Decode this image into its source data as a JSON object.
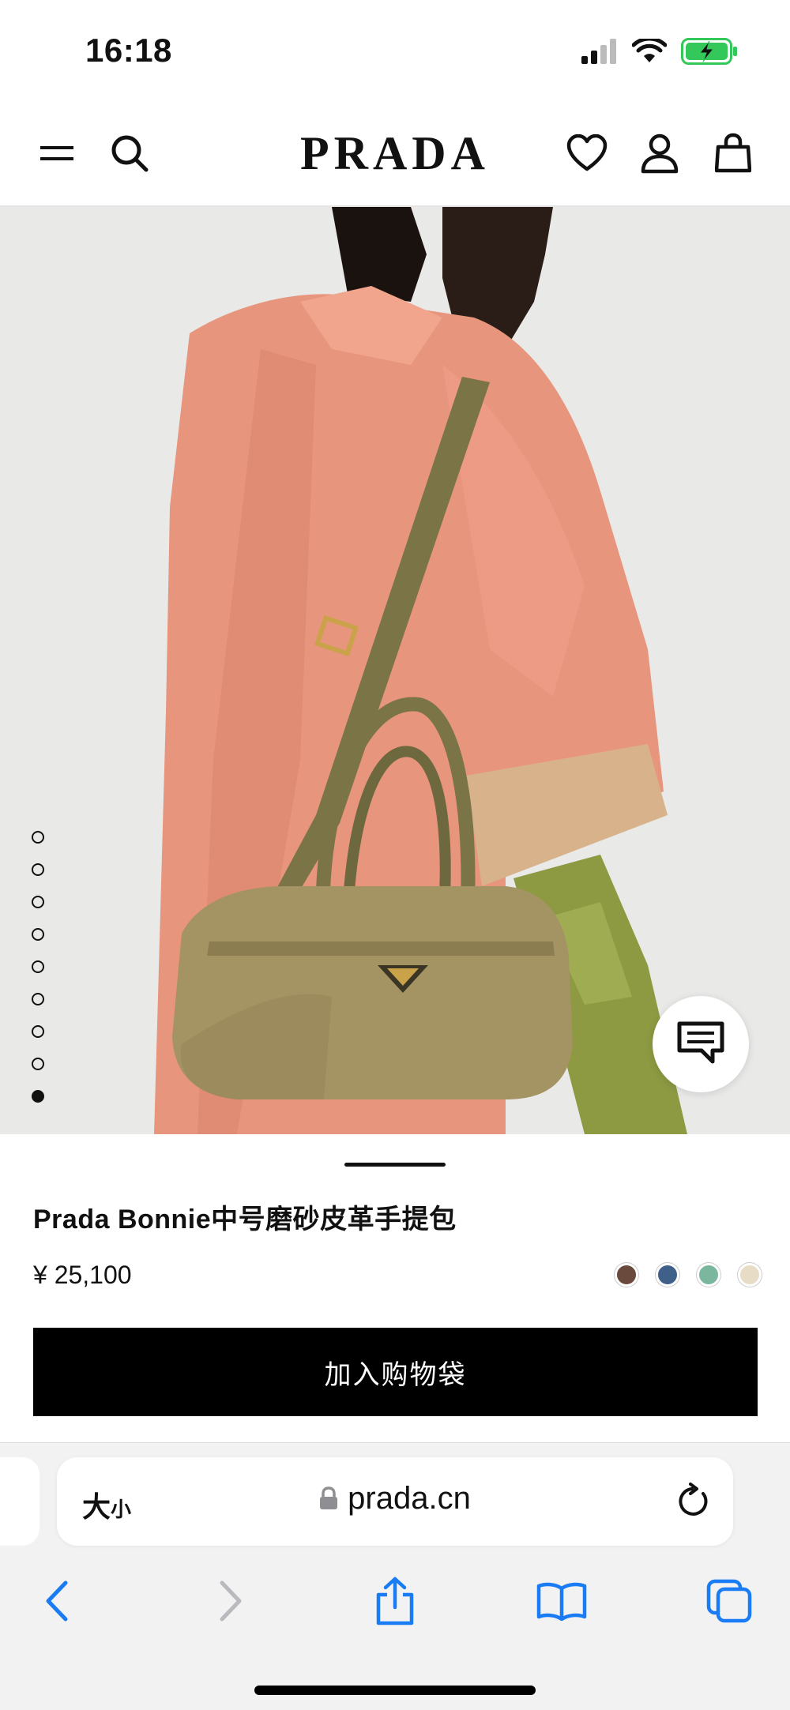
{
  "status_bar": {
    "time": "16:18",
    "icons": [
      "signal-icon",
      "wifi-icon",
      "battery-charging-icon"
    ]
  },
  "header": {
    "logo": "PRADA",
    "icons": [
      "menu-icon",
      "search-icon",
      "heart-icon",
      "account-icon",
      "bag-icon"
    ]
  },
  "gallery": {
    "image_count": 9,
    "active_index": 8,
    "chat_icon": "chat-icon"
  },
  "product": {
    "name": "Prada Bonnie中号磨砂皮革手提包",
    "price": "¥ 25,100",
    "color_swatches": [
      "#6b4a3e",
      "#3f6189",
      "#7bb79e",
      "#e7dcc6"
    ],
    "add_to_bag_label": "加入购物袋"
  },
  "browser": {
    "size_label_big": "大",
    "size_label_small": "小",
    "url": "prada.cn",
    "toolbar_icons": [
      "back-icon",
      "forward-icon",
      "share-icon",
      "bookmarks-icon",
      "tabs-icon"
    ]
  },
  "colors": {
    "accent_blue": "#1a7cf5",
    "button_black": "#000000",
    "battery_green": "#34c759"
  }
}
